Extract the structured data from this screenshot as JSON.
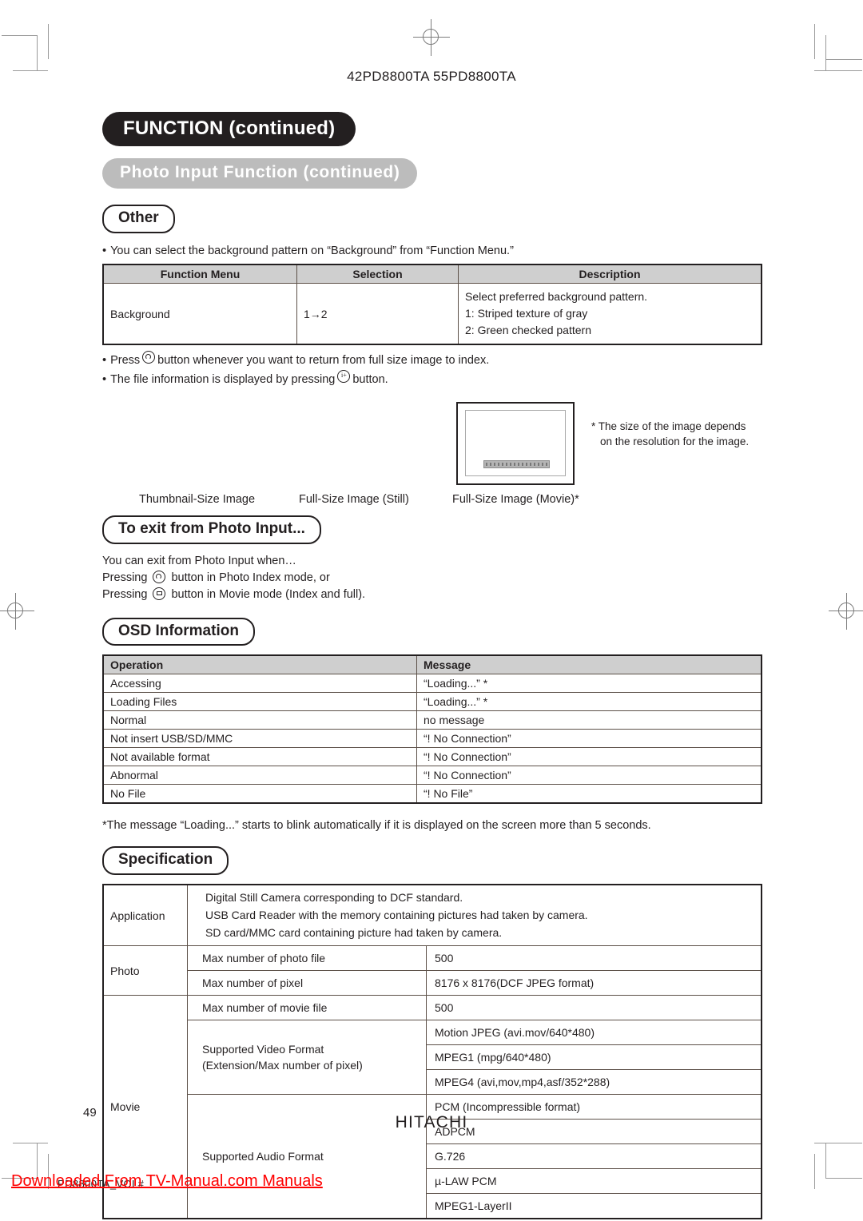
{
  "page": {
    "model_line": "42PD8800TA  55PD8800TA",
    "page_number": "49",
    "brand": "HITACHI",
    "footer_code": "PD8800TA_VOL#",
    "watermark": "Downloaded From TV-Manual.com Manuals"
  },
  "banners": {
    "function": "FUNCTION (continued)",
    "photo_input": "Photo Input Function (continued)"
  },
  "other_section": {
    "title": "Other",
    "intro": "You can select the background pattern on “Background” from “Function Menu.”",
    "table": {
      "headers": [
        "Function Menu",
        "Selection",
        "Description"
      ],
      "rows": [
        {
          "menu": "Background",
          "selection": "1→2",
          "description": [
            "Select preferred background pattern.",
            "1: Striped texture of gray",
            "2: Green checked pattern"
          ]
        }
      ]
    },
    "bullets": [
      {
        "pre": "Press",
        "icon": "back-button-icon",
        "post": "button whenever you want to return from full size image to index."
      },
      {
        "pre": "The file information is displayed by pressing",
        "icon": "info-button-icon",
        "post": "button."
      }
    ]
  },
  "illustration": {
    "note_line1": "* The size of the image depends",
    "note_line2": "on the resolution for the image.",
    "captions": [
      "Thumbnail-Size Image",
      "Full-Size Image (Still)",
      "Full-Size Image (Movie)*"
    ]
  },
  "exit_section": {
    "title": "To exit from Photo Input...",
    "line1": "You can exit from Photo Input when…",
    "line2_pre": "Pressing",
    "line2_icon": "back-button-icon",
    "line2_post": "button in Photo Index mode, or",
    "line3_pre": "Pressing",
    "line3_icon": "camera-button-icon",
    "line3_post": "button in Movie mode (Index and full)."
  },
  "osd_section": {
    "title": "OSD Information",
    "table": {
      "headers": [
        "Operation",
        "Message"
      ],
      "rows": [
        [
          "Accessing",
          "“Loading...” *"
        ],
        [
          "Loading Files",
          "“Loading...” *"
        ],
        [
          "Normal",
          "no message"
        ],
        [
          "Not insert USB/SD/MMC",
          "“! No Connection”"
        ],
        [
          "Not available format",
          "“! No Connection”"
        ],
        [
          "Abnormal",
          "“! No Connection”"
        ],
        [
          "No File",
          "“! No File”"
        ]
      ]
    },
    "footnote": "*The message “Loading...” starts to blink automatically if it is displayed on the screen more than 5 seconds."
  },
  "spec_section": {
    "title": "Specification",
    "application": {
      "label": "Application",
      "lines": [
        "Digital Still Camera corresponding to DCF standard.",
        "USB Card Reader with the memory containing pictures had taken by     camera.",
        "SD card/MMC card containing picture had taken by     camera."
      ]
    },
    "photo": {
      "label": "Photo",
      "rows": [
        [
          "Max number of photo file",
          "500"
        ],
        [
          "Max number of pixel",
          "8176 x 8176(DCF JPEG format)"
        ]
      ]
    },
    "movie": {
      "label": "Movie",
      "max_file_label": "Max number of movie file",
      "max_file_value": "500",
      "video_label_line1": "Supported Video Format",
      "video_label_line2": "(Extension/Max number of pixel)",
      "video_values": [
        "Motion JPEG (avi.mov/640*480)",
        "MPEG1 (mpg/640*480)",
        "MPEG4 (avi,mov,mp4,asf/352*288)"
      ],
      "audio_label": "Supported Audio Format",
      "audio_values": [
        "PCM (Incompressible format)",
        "ADPCM",
        "G.726",
        "µ-LAW PCM",
        "MPEG1-LayerII"
      ]
    }
  },
  "colors": {
    "ink": "#231f20",
    "banner_gray": "#bcbcbc",
    "table_header": "#cfcfcf",
    "table_border": "#5c5048",
    "watermark_red": "#ff0000"
  }
}
